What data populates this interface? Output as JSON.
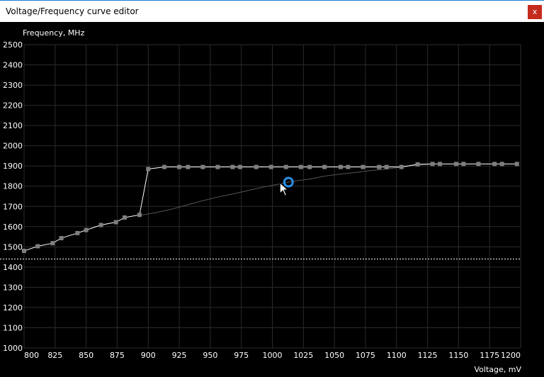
{
  "window": {
    "title": "Voltage/Frequency curve editor",
    "close_label": "x"
  },
  "cursor_icon": "mouse-pointer-icon",
  "chart_data": {
    "type": "line",
    "xlabel": "Voltage, mV",
    "ylabel": "Frequency, MHz",
    "xlim": [
      800,
      1200
    ],
    "ylim": [
      1000,
      2500
    ],
    "x_ticks": [
      800,
      825,
      850,
      875,
      900,
      925,
      950,
      975,
      1000,
      1025,
      1050,
      1075,
      1100,
      1125,
      1150,
      1175,
      1200
    ],
    "y_ticks": [
      1000,
      1100,
      1200,
      1300,
      1400,
      1500,
      1600,
      1700,
      1800,
      1900,
      2000,
      2100,
      2200,
      2300,
      2400,
      2500
    ],
    "grid": true,
    "reference_line_y": 1440,
    "selected_point": {
      "x": 1013,
      "y": 1820
    },
    "series": [
      {
        "role": "current-curve",
        "color": "#ffffff",
        "points": [
          [
            800,
            1480
          ],
          [
            811,
            1503
          ],
          [
            823,
            1518
          ],
          [
            830,
            1543
          ],
          [
            843,
            1568
          ],
          [
            850,
            1583
          ],
          [
            862,
            1608
          ],
          [
            874,
            1622
          ],
          [
            881,
            1645
          ],
          [
            893,
            1658
          ],
          [
            900,
            1885
          ],
          [
            913,
            1895
          ],
          [
            925,
            1895
          ],
          [
            932,
            1895
          ],
          [
            944,
            1895
          ],
          [
            956,
            1895
          ],
          [
            968,
            1895
          ],
          [
            974,
            1895
          ],
          [
            987,
            1895
          ],
          [
            999,
            1895
          ],
          [
            1011,
            1895
          ],
          [
            1023,
            1895
          ],
          [
            1030,
            1895
          ],
          [
            1042,
            1895
          ],
          [
            1055,
            1895
          ],
          [
            1061,
            1895
          ],
          [
            1073,
            1895
          ],
          [
            1086,
            1895
          ],
          [
            1092,
            1895
          ],
          [
            1104,
            1895
          ],
          [
            1117,
            1908
          ],
          [
            1129,
            1910
          ],
          [
            1135,
            1910
          ],
          [
            1148,
            1910
          ],
          [
            1154,
            1910
          ],
          [
            1166,
            1910
          ],
          [
            1179,
            1910
          ],
          [
            1185,
            1910
          ],
          [
            1197,
            1910
          ]
        ]
      },
      {
        "role": "default-curve",
        "color": "#555555",
        "points": [
          [
            893,
            1655
          ],
          [
            905,
            1668
          ],
          [
            918,
            1685
          ],
          [
            930,
            1705
          ],
          [
            942,
            1725
          ],
          [
            955,
            1745
          ],
          [
            967,
            1760
          ],
          [
            980,
            1778
          ],
          [
            992,
            1795
          ],
          [
            1005,
            1810
          ],
          [
            1017,
            1825
          ],
          [
            1030,
            1835
          ],
          [
            1042,
            1850
          ],
          [
            1055,
            1860
          ],
          [
            1067,
            1868
          ],
          [
            1080,
            1878
          ],
          [
            1092,
            1885
          ],
          [
            1105,
            1895
          ],
          [
            1117,
            1905
          ],
          [
            1130,
            1910
          ]
        ]
      }
    ]
  }
}
